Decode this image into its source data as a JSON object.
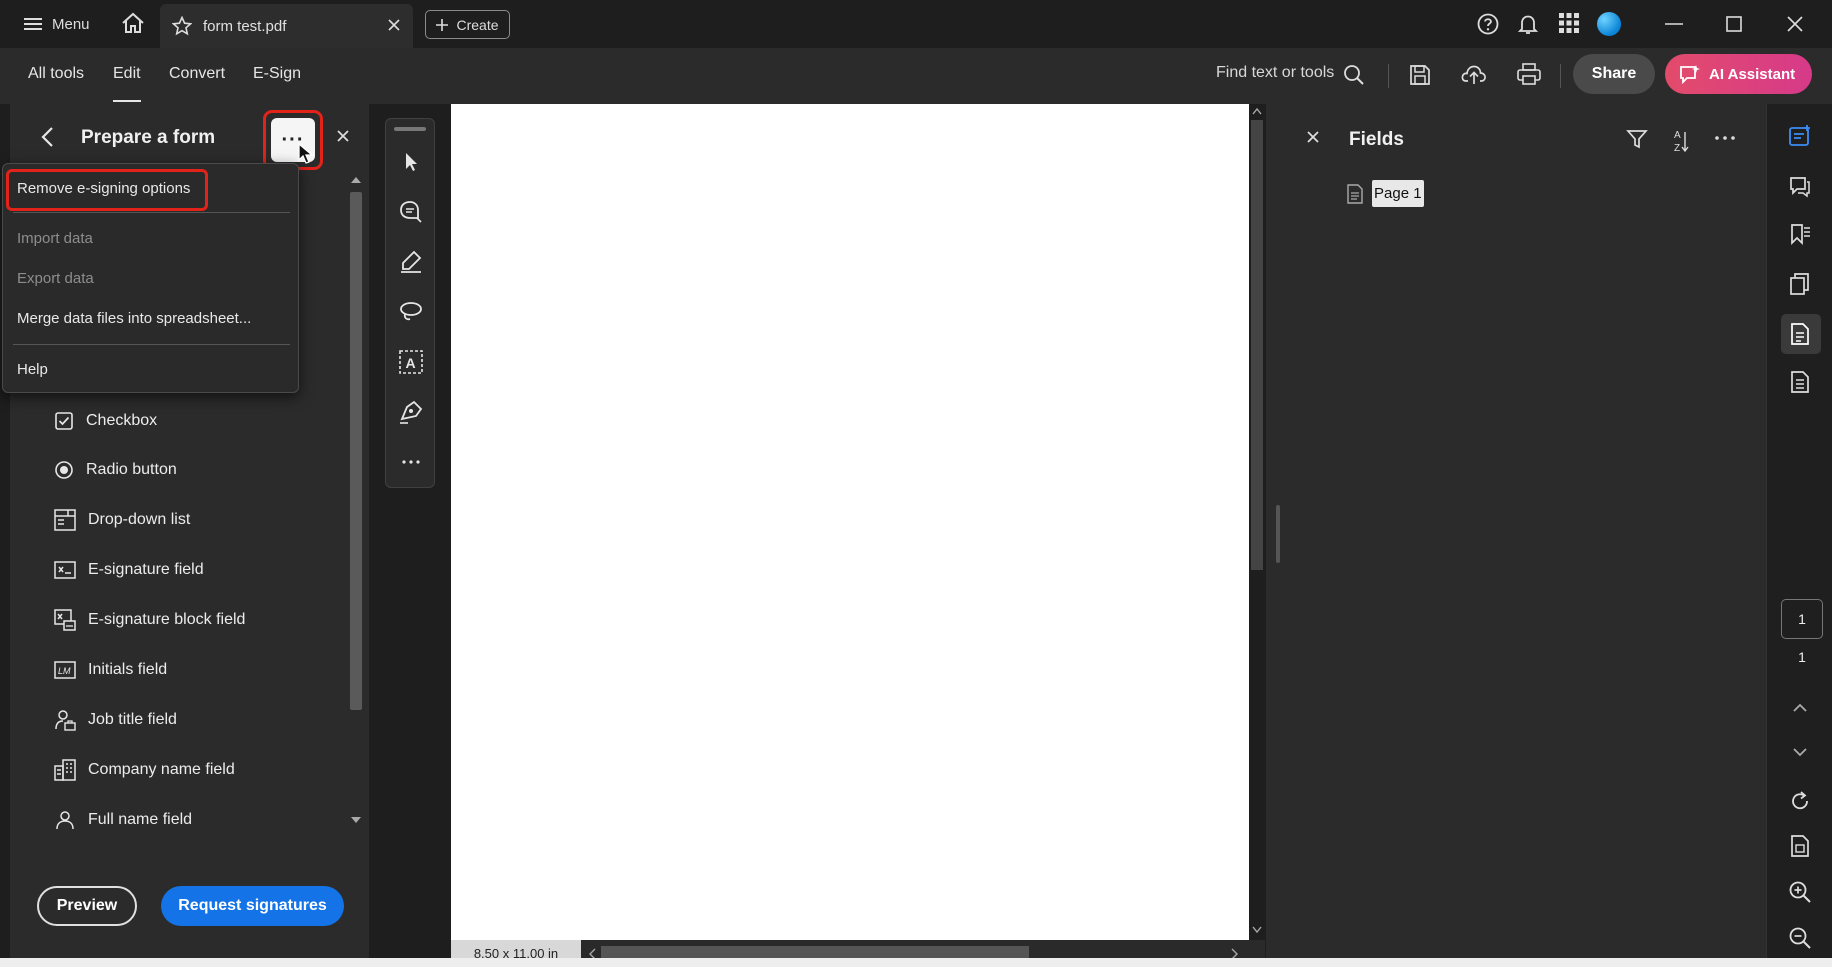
{
  "titlebar": {
    "menu_label": "Menu",
    "tab_title": "form test.pdf",
    "create_label": "Create"
  },
  "menubar": {
    "items": [
      {
        "label": "All tools"
      },
      {
        "label": "Edit",
        "active": true
      },
      {
        "label": "Convert"
      },
      {
        "label": "E-Sign"
      }
    ],
    "find_label": "Find text or tools",
    "share_label": "Share",
    "ai_label": "AI Assistant"
  },
  "left_panel": {
    "title": "Prepare a form",
    "more_glyph": "···",
    "fields": [
      {
        "label": "Checkbox",
        "icon": "checkbox-icon"
      },
      {
        "label": "Radio button",
        "icon": "radio-icon"
      },
      {
        "label": "Drop-down list",
        "icon": "dropdown-list-icon"
      },
      {
        "label": "E-signature field",
        "icon": "esignature-icon"
      },
      {
        "label": "E-signature block field",
        "icon": "esignature-block-icon"
      },
      {
        "label": "Initials field",
        "icon": "initials-icon"
      },
      {
        "label": "Job title field",
        "icon": "job-title-icon"
      },
      {
        "label": "Company name field",
        "icon": "company-icon"
      },
      {
        "label": "Full name field",
        "icon": "person-icon"
      }
    ],
    "preview_label": "Preview",
    "request_label": "Request signatures"
  },
  "dropdown_menu": {
    "items": [
      {
        "label": "Remove e-signing options",
        "enabled": true
      },
      {
        "label": "Import data",
        "enabled": false
      },
      {
        "label": "Export data",
        "enabled": false
      },
      {
        "label": "Merge data files into spreadsheet...",
        "enabled": true
      },
      {
        "label": "Help",
        "enabled": true
      }
    ]
  },
  "document": {
    "page_size": "8.50 x 11.00 in"
  },
  "fields_panel": {
    "title": "Fields",
    "page_node": "Page 1"
  },
  "rail": {
    "current_page": "1",
    "total_pages": "1"
  },
  "colors": {
    "accent_blue": "#1473e6",
    "highlight_red": "#e2231a",
    "ai_gradient_start": "#e34b6b"
  }
}
